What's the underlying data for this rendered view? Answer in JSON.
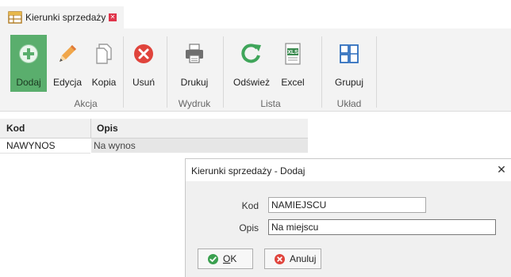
{
  "tab": {
    "title": "Kierunki sprzedaży",
    "close_icon": "close-icon",
    "color_close": "#e0344a"
  },
  "ribbon": {
    "buttons": [
      {
        "label": "Dodaj",
        "icon": "plus-circle-icon",
        "active": true
      },
      {
        "label": "Edycja",
        "icon": "pencil-icon"
      },
      {
        "label": "Kopia",
        "icon": "copy-icon"
      },
      {
        "label": "Usuń",
        "icon": "delete-circle-icon"
      },
      {
        "label": "Drukuj",
        "icon": "printer-icon"
      },
      {
        "label": "Odśwież",
        "icon": "refresh-icon"
      },
      {
        "label": "Excel",
        "icon": "excel-icon"
      },
      {
        "label": "Grupuj",
        "icon": "group-icon"
      }
    ],
    "groups": [
      "Akcja",
      "Wydruk",
      "Lista",
      "Układ"
    ],
    "colors": {
      "active": "#5aae6d",
      "delete": "#e0443c",
      "refresh": "#3fa55a",
      "excel": "#3a8a4f",
      "group": "#2f6fbe"
    }
  },
  "grid": {
    "columns": [
      "Kod",
      "Opis"
    ],
    "rows": [
      {
        "kod": "NAWYNOS",
        "opis": "Na wynos"
      }
    ]
  },
  "dialog": {
    "title": "Kierunki sprzedaży - Dodaj",
    "close": "✕",
    "fields": [
      {
        "label": "Kod",
        "value": "NAMIEJSCU"
      },
      {
        "label": "Opis",
        "value": "Na miejscu"
      }
    ],
    "ok_underline": "O",
    "ok_rest": "K",
    "cancel_label": "Anuluj",
    "colors": {
      "ok": "#3aa04f",
      "cancel": "#e0443c"
    }
  }
}
